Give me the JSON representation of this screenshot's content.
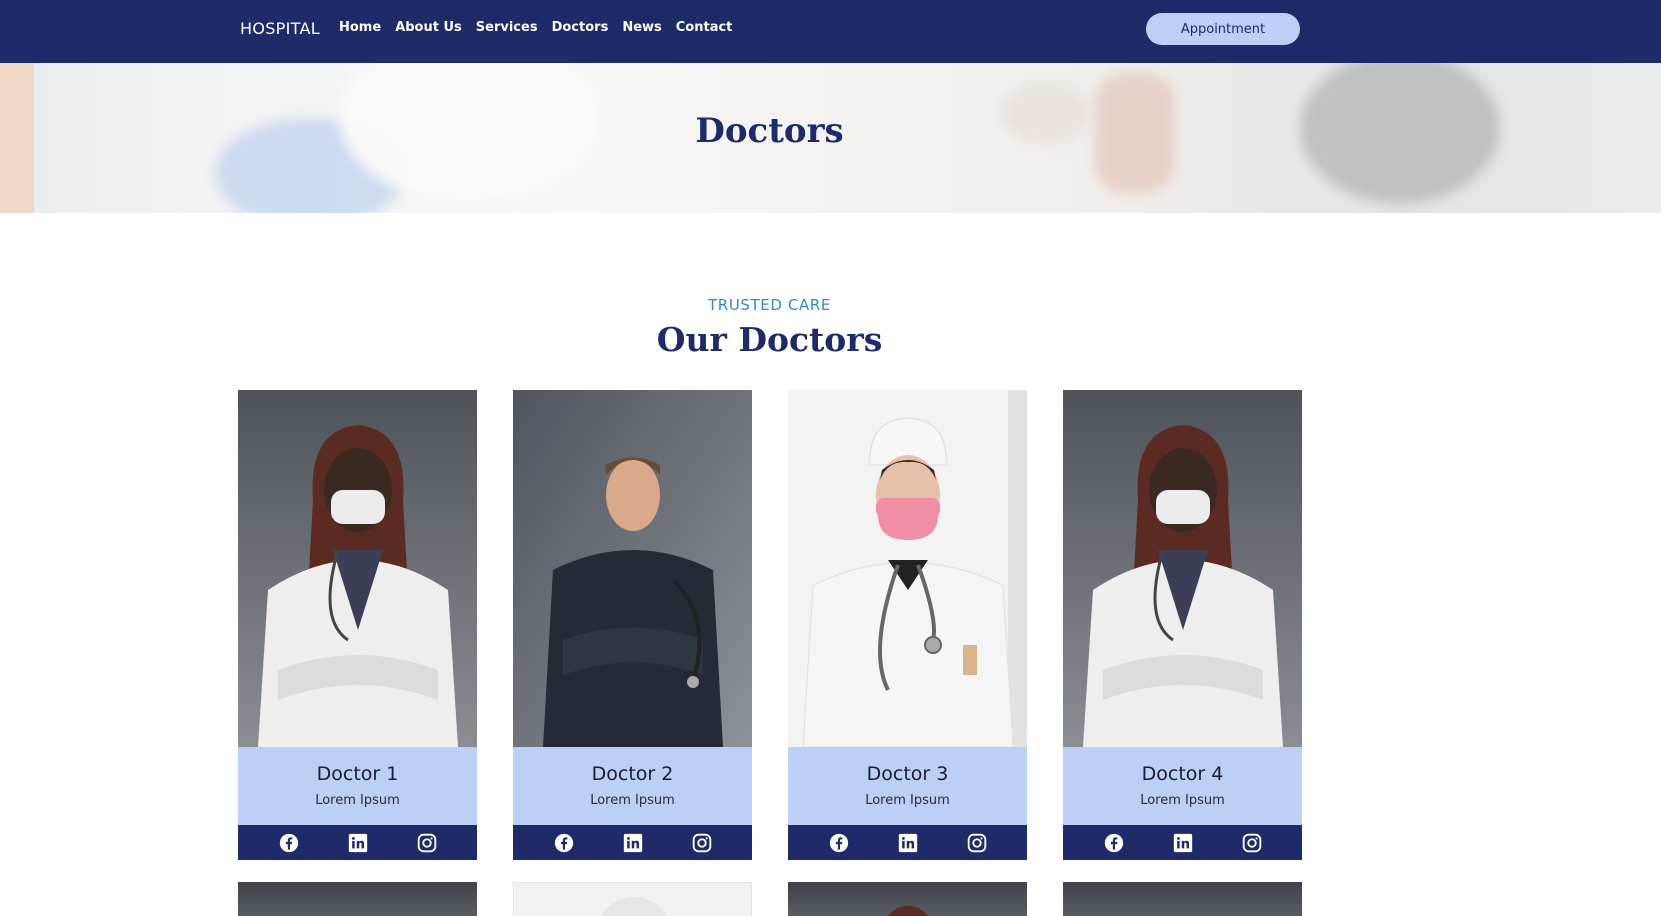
{
  "nav": {
    "brand": "HOSPITAL",
    "links": [
      "Home",
      "About Us",
      "Services",
      "Doctors",
      "News",
      "Contact"
    ],
    "cta": "Appointment"
  },
  "hero": {
    "title": "Doctors"
  },
  "section": {
    "eyebrow": "TRUSTED CARE",
    "title": "Our Doctors"
  },
  "doctors": [
    {
      "name": "Doctor 1",
      "role": "Lorem Ipsum"
    },
    {
      "name": "Doctor 2",
      "role": "Lorem Ipsum"
    },
    {
      "name": "Doctor 3",
      "role": "Lorem Ipsum"
    },
    {
      "name": "Doctor 4",
      "role": "Lorem Ipsum"
    }
  ],
  "social_icons": [
    "facebook-icon",
    "linkedin-icon",
    "instagram-icon"
  ],
  "colors": {
    "navy": "#1f2a68",
    "light_blue": "#bccff5",
    "accent_blue": "#2a8ad6",
    "white": "#ffffff"
  }
}
